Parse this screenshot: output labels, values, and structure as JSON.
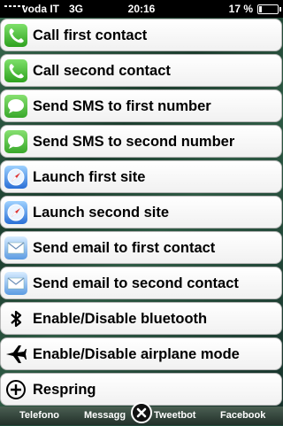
{
  "status_bar": {
    "carrier": "voda IT",
    "network": "3G",
    "time": "20:16",
    "battery": "17 %",
    "battery_level": 0.17
  },
  "menu": {
    "items": [
      {
        "label": "Call first contact",
        "icon": "phone-icon"
      },
      {
        "label": "Call second contact",
        "icon": "phone-icon"
      },
      {
        "label": "Send SMS to first number",
        "icon": "sms-icon"
      },
      {
        "label": "Send SMS to second number",
        "icon": "sms-icon"
      },
      {
        "label": "Launch first site",
        "icon": "safari-icon"
      },
      {
        "label": "Launch second site",
        "icon": "safari-icon"
      },
      {
        "label": "Send email to first contact",
        "icon": "mail-icon"
      },
      {
        "label": "Send email to second contact",
        "icon": "mail-icon"
      },
      {
        "label": "Enable/Disable bluetooth",
        "icon": "bluetooth-icon"
      },
      {
        "label": "Enable/Disable airplane mode",
        "icon": "airplane-icon"
      },
      {
        "label": "Respring",
        "icon": "add-circle-icon"
      }
    ]
  },
  "dock": {
    "apps": [
      "Telefono",
      "Messagg",
      "Tweetbot",
      "Facebook"
    ]
  }
}
